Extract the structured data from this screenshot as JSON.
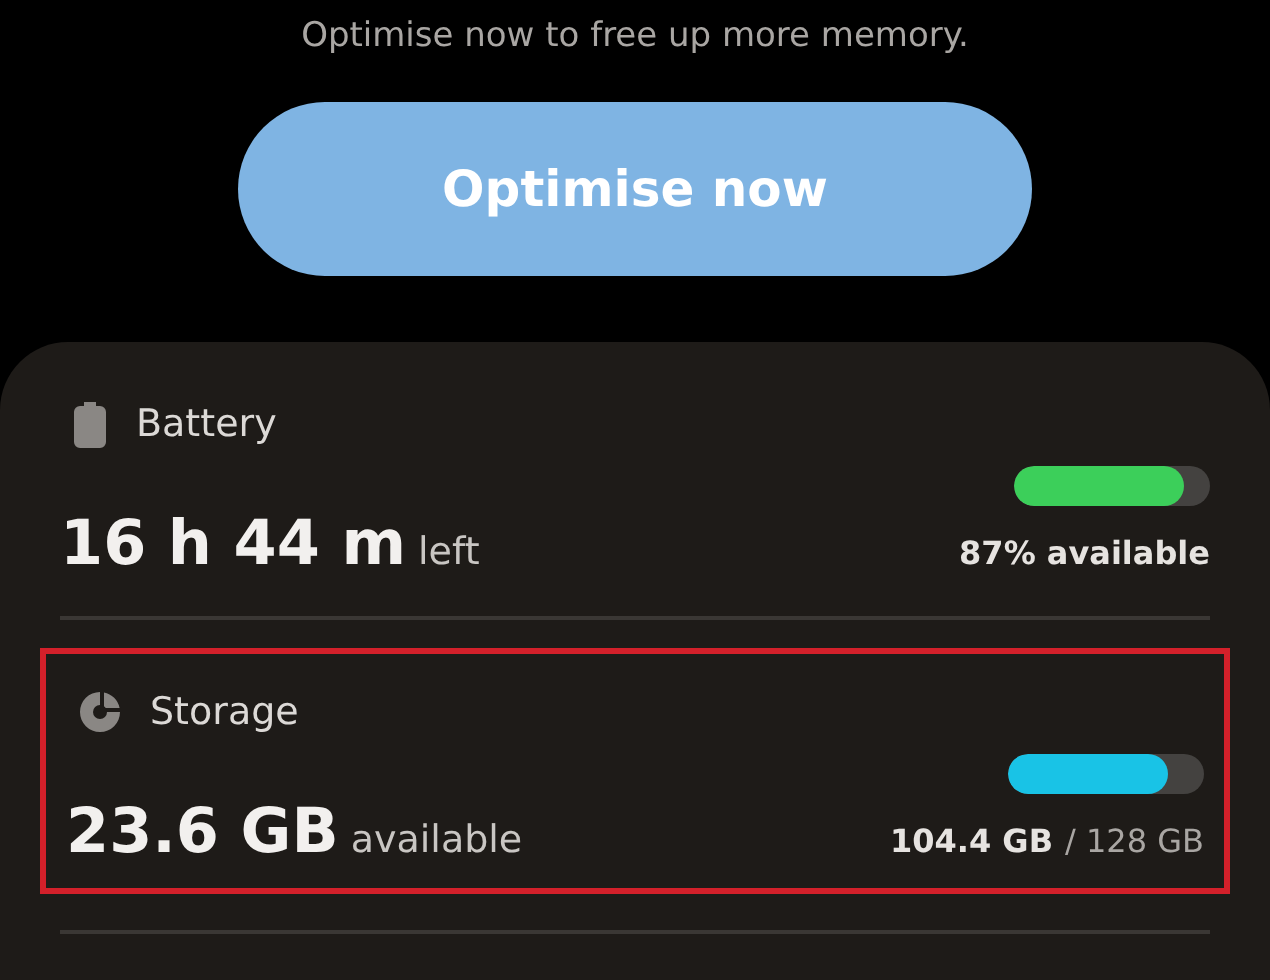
{
  "prompt": "Optimise now to free up more memory.",
  "optimise_button": "Optimise now",
  "items": [
    {
      "kind": "battery",
      "title": "Battery",
      "value": "16 h 44 m",
      "suffix": "left",
      "level": 0.87,
      "color": "#3ccf5a",
      "detail": "87% available",
      "highlighted": false
    },
    {
      "kind": "storage",
      "title": "Storage",
      "value": "23.6 GB",
      "suffix": "available",
      "level": 0.82,
      "color": "#19c3e6",
      "detail": "104.4 GB",
      "detail_extra": "/ 128 GB",
      "highlighted": true
    }
  ]
}
